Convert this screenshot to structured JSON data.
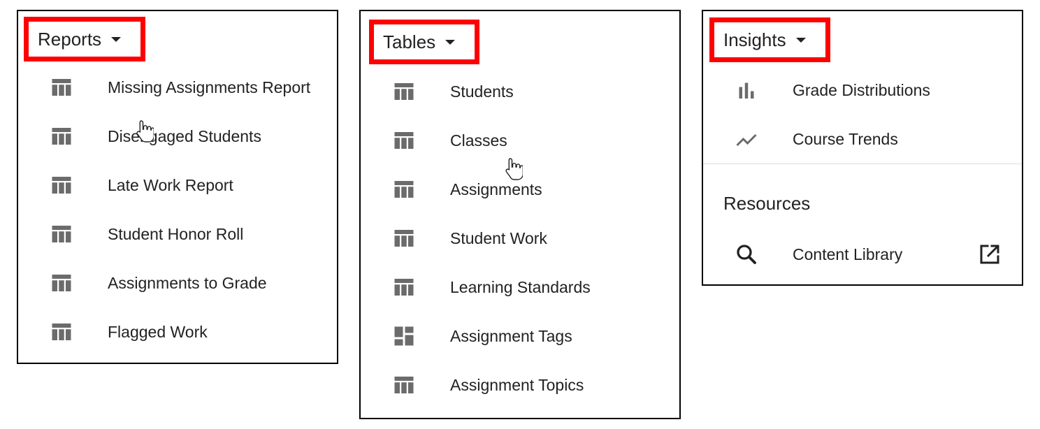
{
  "reports": {
    "label": "Reports",
    "items": [
      {
        "label": "Missing Assignments Report",
        "icon": "table-icon"
      },
      {
        "label": "Disengaged Students",
        "icon": "table-icon"
      },
      {
        "label": "Late Work Report",
        "icon": "table-icon"
      },
      {
        "label": "Student Honor Roll",
        "icon": "table-icon"
      },
      {
        "label": "Assignments to Grade",
        "icon": "table-icon"
      },
      {
        "label": "Flagged Work",
        "icon": "table-icon"
      }
    ]
  },
  "tables": {
    "label": "Tables",
    "items": [
      {
        "label": "Students",
        "icon": "table-icon"
      },
      {
        "label": "Classes",
        "icon": "table-icon"
      },
      {
        "label": "Assignments",
        "icon": "table-icon"
      },
      {
        "label": "Student Work",
        "icon": "table-icon"
      },
      {
        "label": "Learning Standards",
        "icon": "table-icon"
      },
      {
        "label": "Assignment Tags",
        "icon": "dashboard-icon"
      },
      {
        "label": "Assignment Topics",
        "icon": "table-icon"
      }
    ]
  },
  "insights": {
    "label": "Insights",
    "items": [
      {
        "label": "Grade Distributions",
        "icon": "bar-chart-icon"
      },
      {
        "label": "Course Trends",
        "icon": "trend-line-icon"
      }
    ],
    "resources": {
      "title": "Resources",
      "items": [
        {
          "label": "Content Library",
          "icon": "search-icon",
          "action_icon": "open-in-new-icon"
        }
      ]
    }
  },
  "colors": {
    "highlight": "#ff0000",
    "icon": "#6b6b6b",
    "text": "#222222",
    "border": "#000000"
  }
}
